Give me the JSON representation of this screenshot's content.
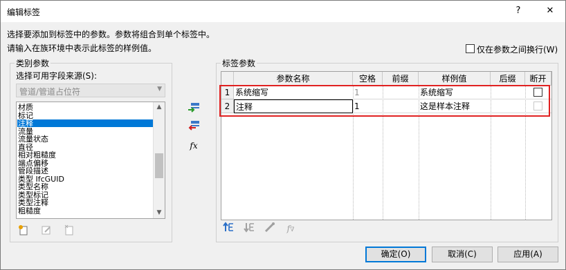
{
  "dialog": {
    "title": "编辑标签",
    "help_label": "?",
    "close_label": "✕"
  },
  "instructions": {
    "line1": "选择要添加到标签中的参数。参数将组合到单个标签中。",
    "line2": "请输入在族环境中表示此标签的样例值。"
  },
  "wrap_option": {
    "label": "仅在参数之间换行(W)",
    "checked": false
  },
  "category": {
    "group_title": "类别参数",
    "source_label": "选择可用字段来源(S):",
    "source_value": "管道/管道占位符",
    "items": [
      "材质",
      "标记",
      "注释",
      "流量",
      "流量状态",
      "直径",
      "相对粗糙度",
      "端点偏移",
      "管段描述",
      "类型 IfcGUID",
      "类型名称",
      "类型标记",
      "类型注释",
      "粗糙度"
    ],
    "selected_index": 2
  },
  "middle_icons": [
    "add-param-icon",
    "remove-param-icon",
    "fx-icon"
  ],
  "fx_label": "fx",
  "label_params": {
    "group_title": "标签参数",
    "columns": [
      "参数名称",
      "空格",
      "前缀",
      "样例值",
      "后缀",
      "断开"
    ],
    "rows": [
      {
        "num": "1",
        "name": "系统缩写",
        "space": "1",
        "prefix": "",
        "sample": "系统缩写",
        "suffix": "",
        "break": false
      },
      {
        "num": "2",
        "name": "注释",
        "space": "1",
        "prefix": "",
        "sample": "这是样本注释",
        "suffix": "",
        "break": false
      }
    ]
  },
  "buttons": {
    "ok": "确定(O)",
    "cancel": "取消(C)",
    "apply": "应用(A)"
  },
  "colors": {
    "highlight_box": "#e02020",
    "selection": "#0078d7"
  }
}
